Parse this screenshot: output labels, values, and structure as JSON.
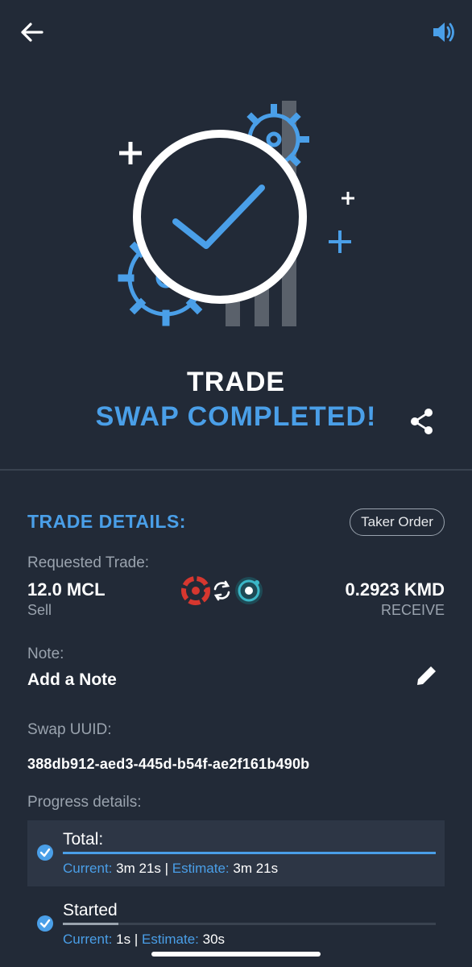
{
  "icons": {
    "back": "arrow-left-icon",
    "sound": "speaker-icon",
    "share": "share-icon",
    "edit": "pencil-icon",
    "check": "check-circle-icon"
  },
  "colors": {
    "background": "#222a37",
    "accent": "#4a9fe8",
    "muted": "#9aa3ae",
    "panel": "#2d3645"
  },
  "header": {
    "line1": "TRADE",
    "line2": "SWAP COMPLETED!"
  },
  "details": {
    "title": "TRADE DETAILS:",
    "order_type": "Taker Order",
    "requested_label": "Requested Trade:",
    "sell_amount": "12.0 MCL",
    "sell_label": "Sell",
    "receive_amount": "0.2923 KMD",
    "receive_label": "RECEIVE",
    "note_label": "Note:",
    "note_value": "Add a Note",
    "uuid_label": "Swap UUID:",
    "uuid_value": "388db912-aed3-445d-b54f-ae2f161b490b",
    "progress_label": "Progress details:"
  },
  "progress": [
    {
      "name": "Total:",
      "current_label": "Current:",
      "current": "3m 21s",
      "separator": "|",
      "estimate_label": "Estimate:",
      "estimate": "3m 21s",
      "fill": 1.0
    },
    {
      "name": "Started",
      "current_label": "Current:",
      "current": "1s",
      "separator": "|",
      "estimate_label": "Estimate:",
      "estimate": "30s",
      "fill": 0.15
    }
  ]
}
